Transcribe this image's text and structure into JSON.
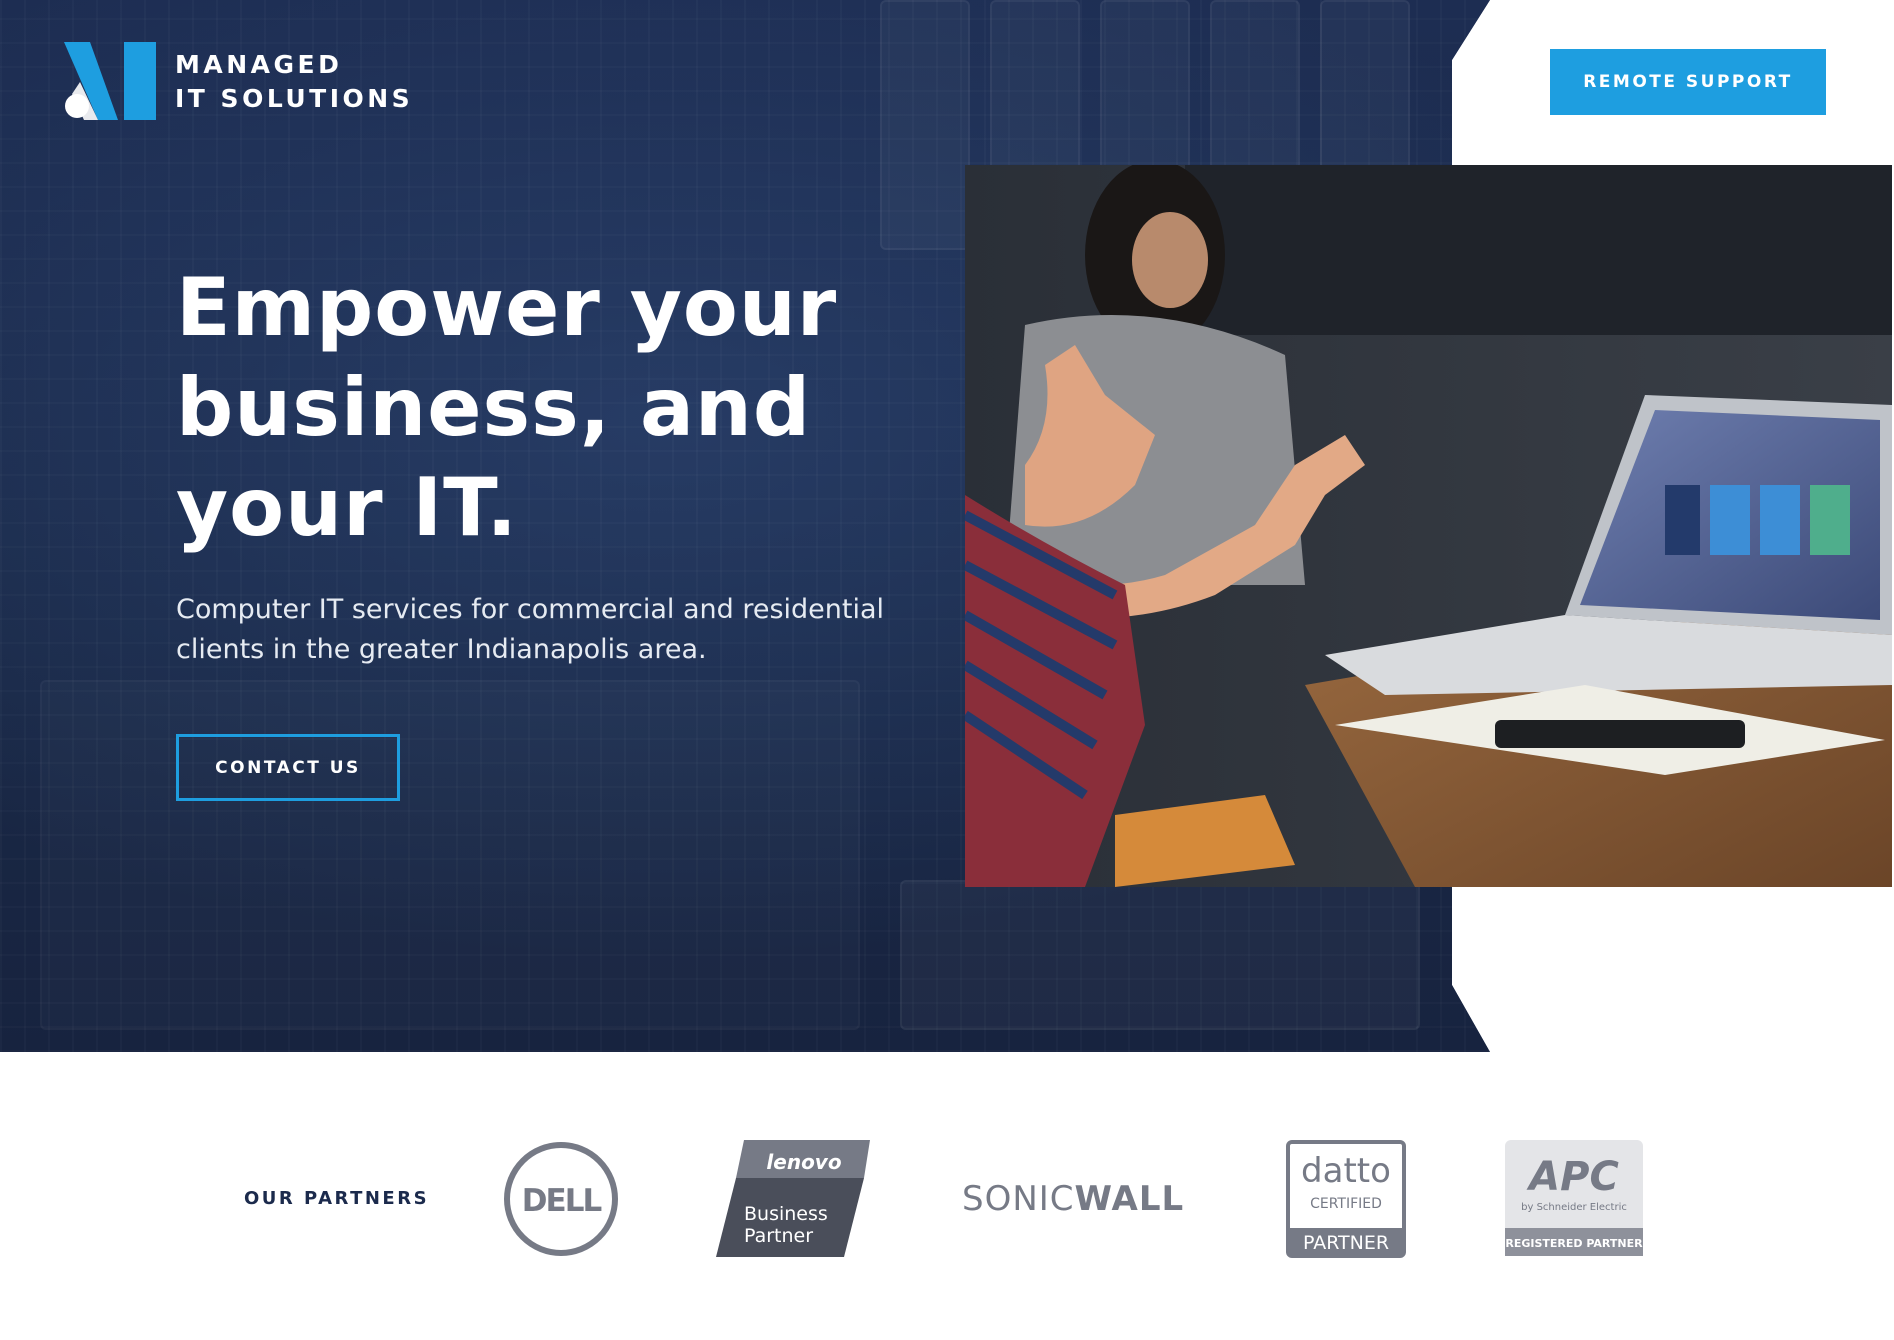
{
  "brand": {
    "name_line1": "MANAGED",
    "name_line2": "IT SOLUTIONS",
    "accent_color": "#1e9ee0",
    "navy_color": "#1b2a4c"
  },
  "header": {
    "remote_support_label": "REMOTE SUPPORT"
  },
  "hero": {
    "headline_line1": "Empower your",
    "headline_line2": "business, and",
    "headline_line3": "your IT.",
    "subtext_line1": "Computer IT services for commercial and residential",
    "subtext_line2": "clients in the greater Indianapolis area.",
    "contact_label": "CONTACT US"
  },
  "partners": {
    "label": "OUR PARTNERS",
    "dell": "DELL",
    "lenovo_brand": "lenovo",
    "lenovo_line1": "Business",
    "lenovo_line2": "Partner",
    "sonicwall_a": "SONIC",
    "sonicwall_b": "WALL",
    "datto_brand": "datto",
    "datto_certified": "CERTIFIED",
    "datto_partner": "PARTNER",
    "apc_brand": "APC",
    "apc_sub": "by Schneider Electric",
    "apc_registered": "REGISTERED PARTNER"
  }
}
